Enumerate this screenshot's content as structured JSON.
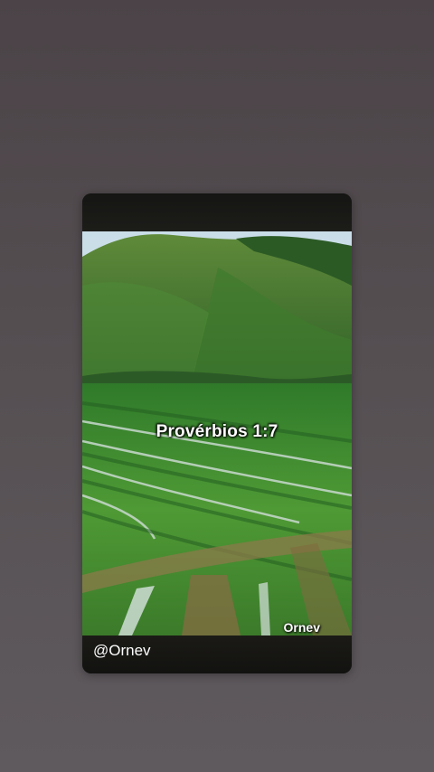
{
  "story": {
    "caption": "Provérbios 1:7",
    "watermark": "Ornev",
    "handle": "@Ornev"
  },
  "colors": {
    "background": "#524c50",
    "caption_text": "#ffffff"
  }
}
